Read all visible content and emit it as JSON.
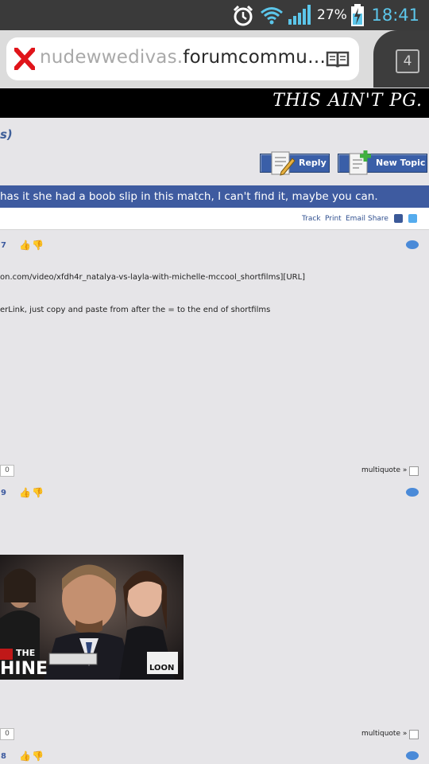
{
  "status_bar": {
    "battery_percent": "27%",
    "time": "18:41"
  },
  "browser": {
    "url_dim": "nudewwedivas.",
    "url_main": "forumcommu…",
    "tab_count": "4"
  },
  "forum": {
    "slogan": "THIS AIN'T PG.",
    "breadcrumb_tail": "s)",
    "reply_label": "Reply",
    "new_topic_label": "New Topic",
    "thread_title": "has it she had a boob slip in this match, I can't find it, maybe you can.",
    "tools": {
      "track": "Track",
      "print": "Print",
      "email": "Email",
      "share": "Share"
    }
  },
  "posts": [
    {
      "number": "7",
      "line1": "on.com/video/xfdh4r_natalya-vs-layla-with-michelle-mccool_shortfilms][URL]",
      "line2": "erLink, just copy and paste from after the = to the end of shortfilms",
      "count": "0",
      "multiquote": "multiquote »"
    },
    {
      "number": "9",
      "image_text_left": "HINE",
      "image_text_small": "THE",
      "image_brand": "LOON",
      "count": "0",
      "multiquote": "multiquote »"
    },
    {
      "number": "8"
    }
  ]
}
